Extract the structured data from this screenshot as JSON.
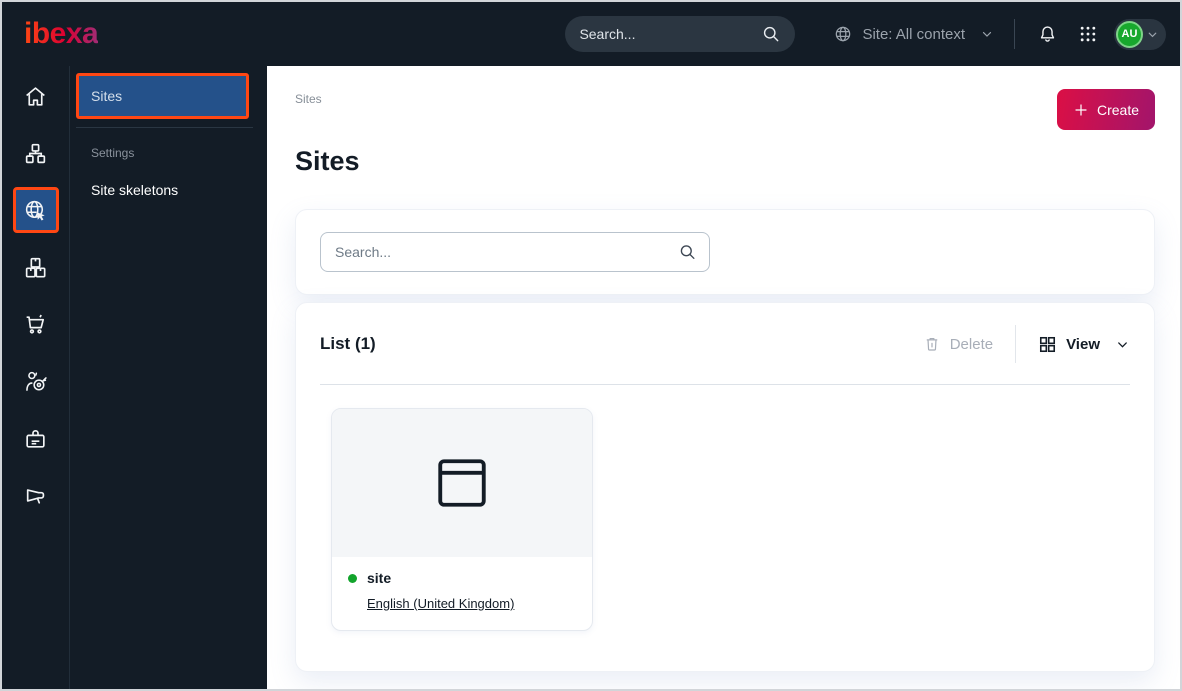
{
  "topbar": {
    "logo_text": "ibexa",
    "search": {
      "placeholder": "Search...",
      "icon": "search-icon"
    },
    "site_context": {
      "label": "Site: All context",
      "icon": "globe-icon"
    },
    "action_icons": [
      "bell-icon",
      "apps-grid-icon"
    ],
    "avatar": {
      "initials": "AU",
      "color": "#18a82d"
    }
  },
  "rail": {
    "icons": [
      "home-icon",
      "content-tree-icon",
      "site-globe-icon",
      "blocks-icon",
      "cart-icon",
      "personalization-icon",
      "badge-icon",
      "megaphone-icon"
    ],
    "active_icon": "site-globe-icon"
  },
  "sidebar": {
    "active_item": "Sites",
    "section_label": "Settings",
    "items": [
      {
        "label": "Site skeletons"
      }
    ]
  },
  "main": {
    "breadcrumb": "Sites",
    "create_button": "Create",
    "title": "Sites",
    "search_placeholder": "Search...",
    "list": {
      "title": "List (1)",
      "delete_label": "Delete",
      "view_label": "View"
    },
    "sites": [
      {
        "name": "site",
        "language": "English (United Kingdom)",
        "status_color": "#12a42c",
        "preview_icon": "browser-window-icon"
      }
    ]
  },
  "colors": {
    "topbar_bg": "#131c26",
    "highlight_blue": "#24518a",
    "annotation_orange": "#ff4713",
    "create_gradient_start": "#db0f45",
    "create_gradient_end": "#a2156b",
    "status_green": "#12a42c",
    "avatar_green": "#18a82d"
  }
}
